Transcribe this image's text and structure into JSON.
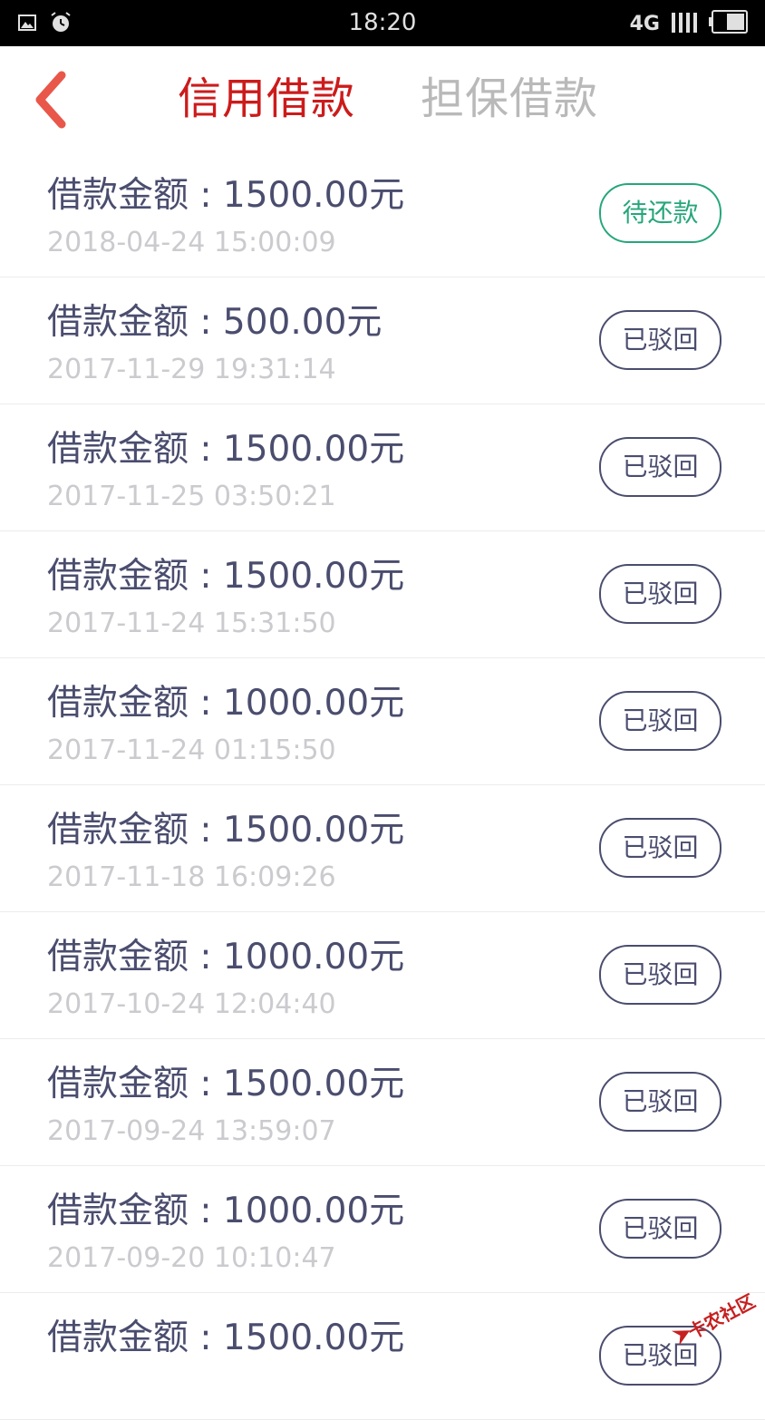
{
  "status_bar": {
    "time": "18:20",
    "network": "4G",
    "icons": [
      "image-icon",
      "alarm-icon",
      "signal-icon",
      "battery-icon"
    ]
  },
  "header": {
    "back_icon": "chevron-left-icon",
    "tabs": [
      {
        "label": "信用借款",
        "active": true
      },
      {
        "label": "担保借款",
        "active": false
      }
    ]
  },
  "colors": {
    "active_tab": "#cc1b1b",
    "inactive_tab": "#b9b9b9",
    "amount_text": "#4a4d6e",
    "date_text": "#cbcbcf",
    "pending_status": "#26a67b",
    "rejected_status": "#4a4d6e"
  },
  "loans": [
    {
      "amount": "借款金额 : 1500.00元",
      "date": "2018-04-24 15:00:09",
      "status": "待还款",
      "pending": true
    },
    {
      "amount": "借款金额 : 500.00元",
      "date": "2017-11-29 19:31:14",
      "status": "已驳回",
      "pending": false
    },
    {
      "amount": "借款金额 : 1500.00元",
      "date": "2017-11-25 03:50:21",
      "status": "已驳回",
      "pending": false
    },
    {
      "amount": "借款金额 : 1500.00元",
      "date": "2017-11-24 15:31:50",
      "status": "已驳回",
      "pending": false
    },
    {
      "amount": "借款金额 : 1000.00元",
      "date": "2017-11-24 01:15:50",
      "status": "已驳回",
      "pending": false
    },
    {
      "amount": "借款金额 : 1500.00元",
      "date": "2017-11-18 16:09:26",
      "status": "已驳回",
      "pending": false
    },
    {
      "amount": "借款金额 : 1000.00元",
      "date": "2017-10-24 12:04:40",
      "status": "已驳回",
      "pending": false
    },
    {
      "amount": "借款金额 : 1500.00元",
      "date": "2017-09-24 13:59:07",
      "status": "已驳回",
      "pending": false
    },
    {
      "amount": "借款金额 : 1000.00元",
      "date": "2017-09-20 10:10:47",
      "status": "已驳回",
      "pending": false
    },
    {
      "amount": "借款金额 : 1500.00元",
      "date": "",
      "status": "已驳回",
      "pending": false
    }
  ],
  "watermark": {
    "text": "卡农社区"
  }
}
